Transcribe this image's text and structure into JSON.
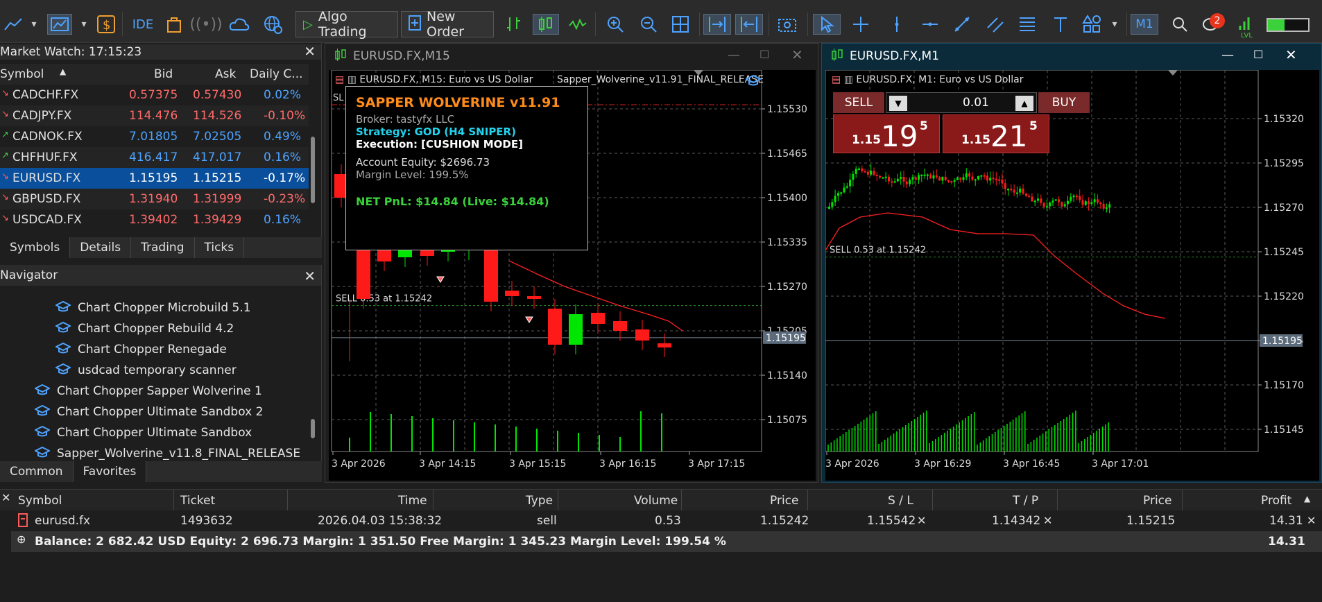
{
  "toolbar": {
    "algo_trading_label": "Algo Trading",
    "new_order_label": "New Order",
    "ide_label": "IDE",
    "timeframe_label": "M1",
    "notification_count": "2",
    "lvl_label": "LVL"
  },
  "market_watch": {
    "title": "Market Watch: 17:15:23",
    "columns": [
      "Symbol",
      "Bid",
      "Ask",
      "Daily C..."
    ],
    "rows": [
      {
        "symbol": "CADCHF.FX",
        "bid": "0.57375",
        "ask": "0.57430",
        "change": "0.02%",
        "dir": "down"
      },
      {
        "symbol": "CADJPY.FX",
        "bid": "114.476",
        "ask": "114.526",
        "change": "-0.10%",
        "dir": "down"
      },
      {
        "symbol": "CADNOK.FX",
        "bid": "7.01805",
        "ask": "7.02505",
        "change": "0.49%",
        "dir": "up"
      },
      {
        "symbol": "CHFHUF.FX",
        "bid": "416.417",
        "ask": "417.017",
        "change": "0.16%",
        "dir": "up"
      },
      {
        "symbol": "EURUSD.FX",
        "bid": "1.15195",
        "ask": "1.15215",
        "change": "-0.17%",
        "dir": "down"
      },
      {
        "symbol": "GBPUSD.FX",
        "bid": "1.31940",
        "ask": "1.31999",
        "change": "-0.23%",
        "dir": "down"
      },
      {
        "symbol": "USDCAD.FX",
        "bid": "1.39402",
        "ask": "1.39429",
        "change": "0.16%",
        "dir": "down"
      }
    ],
    "tabs": [
      "Symbols",
      "Details",
      "Trading",
      "Ticks"
    ]
  },
  "navigator": {
    "title": "Navigator",
    "items": [
      {
        "label": "Chart Chopper Microbuild 5.1",
        "indent": 2
      },
      {
        "label": "Chart Chopper Rebuild 4.2",
        "indent": 2
      },
      {
        "label": "Chart Chopper Renegade",
        "indent": 2
      },
      {
        "label": "usdcad temporary scanner",
        "indent": 2
      },
      {
        "label": "Chart Chopper Sapper Wolverine 1",
        "indent": 1
      },
      {
        "label": "Chart Chopper Ultimate Sandbox 2",
        "indent": 1
      },
      {
        "label": "Chart Chopper Ultimate Sandbox",
        "indent": 1
      },
      {
        "label": "Sapper_Wolverine_v11.8_FINAL_RELEASE",
        "indent": 1
      }
    ],
    "tabs": [
      "Common",
      "Favorites"
    ]
  },
  "chart1": {
    "window_title": "EURUSD.FX,M15",
    "header": "EURUSD.FX, M15:  Euro vs US Dollar",
    "ea_name": "Sapper_Wolverine_v11.91_FINAL_RELEASE",
    "price_labels": [
      "1.15530",
      "1.15465",
      "1.15400",
      "1.15335",
      "1.15270",
      "1.15205",
      "1.15140",
      "1.15075"
    ],
    "current_price": "1.15195",
    "time_labels": [
      "3 Apr 2026",
      "3 Apr 14:15",
      "3 Apr 15:15",
      "3 Apr 16:15",
      "3 Apr 17:15"
    ],
    "sell_line_label": "SELL 0.53 at 1.15242",
    "sl_label": "SL"
  },
  "chart2": {
    "window_title": "EURUSD.FX,M1",
    "header": "EURUSD.FX, M1:  Euro vs US Dollar",
    "price_labels": [
      "1.15320",
      "1.15295",
      "1.15270",
      "1.15245",
      "1.15220",
      "1.15195",
      "1.15170",
      "1.15145"
    ],
    "current_price": "1.15195",
    "time_labels": [
      "3 Apr 2026",
      "3 Apr 16:29",
      "3 Apr 16:45",
      "3 Apr 17:01"
    ],
    "sell_line_label": "SELL 0.53 at 1.15242",
    "one_click": {
      "sell_label": "SELL",
      "buy_label": "BUY",
      "volume": "0.01",
      "sell_prefix": "1.15",
      "sell_big": "19",
      "sell_sup": "5",
      "buy_prefix": "1.15",
      "buy_big": "21",
      "buy_sup": "5"
    }
  },
  "infobox": {
    "title": "SAPPER WOLVERINE v11.91",
    "broker": "Broker: tastyfx LLC",
    "strategy": "Strategy: GOD (H4 SNIPER)",
    "execution": "Execution: [CUSHION MODE]",
    "equity": "Account Equity: $2696.73",
    "margin": "Margin Level: 199.5%",
    "pnl": "NET PnL: $14.84 (Live: $14.84)"
  },
  "trade": {
    "columns": [
      "Symbol",
      "Ticket",
      "Time",
      "Type",
      "Volume",
      "Price",
      "S / L",
      "T / P",
      "Price",
      "Profit"
    ],
    "row": {
      "symbol": "eurusd.fx",
      "ticket": "1493632",
      "time": "2026.04.03 15:38:32",
      "type": "sell",
      "volume": "0.53",
      "price": "1.15242",
      "sl": "1.15542",
      "tp": "1.14342",
      "current": "1.15215",
      "profit": "14.31"
    },
    "balance_text": "Balance: 2 682.42 USD  Equity: 2 696.73  Margin: 1 351.50  Free Margin: 1 345.23  Margin Level: 199.54 %",
    "balance_profit": "14.31"
  },
  "colors": {
    "bull": "#00e600",
    "bear": "#ff1a1a",
    "ma": "#ff2020",
    "grid": "#5a5a5a",
    "accent": "#4ea3ff"
  }
}
